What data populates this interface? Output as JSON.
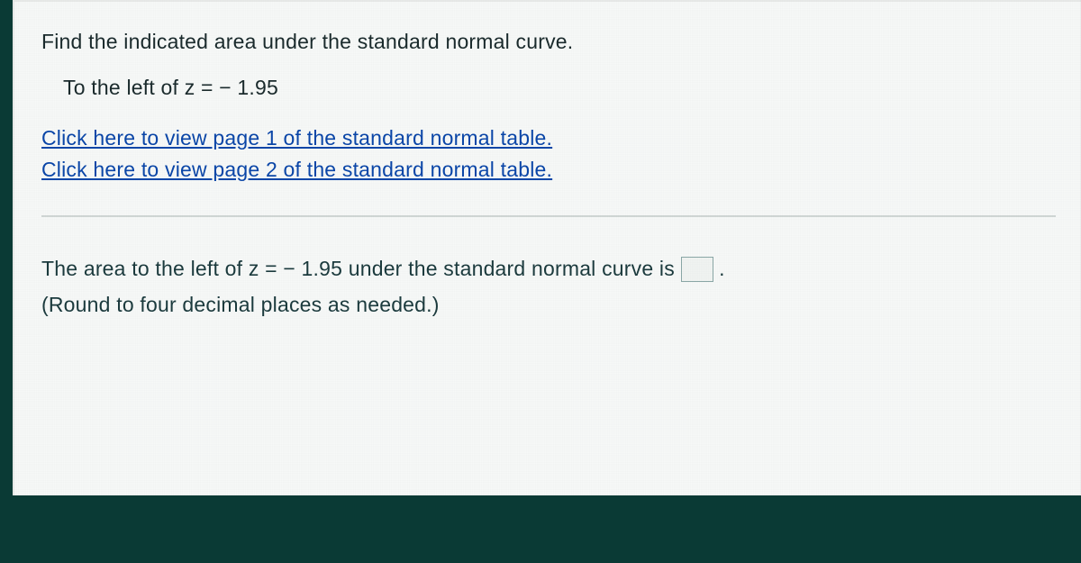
{
  "question": {
    "prompt": "Find the indicated area under the standard normal curve.",
    "detail": "To the left of z = − 1.95"
  },
  "links": {
    "table_page1": "Click here to view page 1 of the standard normal table.",
    "table_page2": "Click here to view page 2 of the standard normal table."
  },
  "answer": {
    "prefix": "The area to the left of z = − 1.95 under the standard normal curve is ",
    "suffix": ".",
    "value": "",
    "hint": "(Round to four decimal places as needed.)"
  }
}
